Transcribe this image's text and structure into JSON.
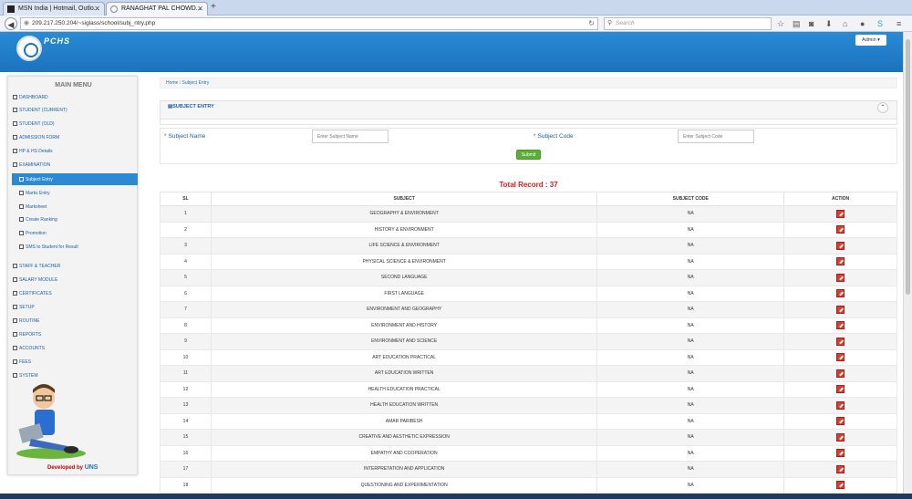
{
  "browser": {
    "tabs": [
      {
        "title": "MSN India | Hotmail, Outlo..."
      },
      {
        "title": "RANAGHAT PAL CHOWD..."
      }
    ],
    "url": "209.217.250.204/~siglass/school/subj_ntry.php",
    "search_placeholder": "Search"
  },
  "header": {
    "brand": "PCHS",
    "admin_label": "Admin ▾"
  },
  "sidebar": {
    "title": "MAIN MENU",
    "items": [
      {
        "label": "DASHBOARD",
        "level": 0
      },
      {
        "label": "STUDENT (CURRENT)",
        "level": 0
      },
      {
        "label": "STUDENT (OLD)",
        "level": 0
      },
      {
        "label": "ADMISSION FORM",
        "level": 0
      },
      {
        "label": "HP & HS Details",
        "level": 0
      },
      {
        "label": "EXAMINATION",
        "level": 0
      },
      {
        "label": "Subject Entry",
        "level": 1,
        "active": true
      },
      {
        "label": "Marks Entry",
        "level": 1
      },
      {
        "label": "Marksheet",
        "level": 1
      },
      {
        "label": "Create Ranking",
        "level": 1
      },
      {
        "label": "Promotion",
        "level": 1
      },
      {
        "label": "SMS to Student for Result",
        "level": 1
      },
      {
        "label": "STAFF & TEACHER",
        "level": 0
      },
      {
        "label": "SALARY MODULE",
        "level": 0
      },
      {
        "label": "CERTIFICATES",
        "level": 0
      },
      {
        "label": "SETUP",
        "level": 0
      },
      {
        "label": "ROUTINE",
        "level": 0
      },
      {
        "label": "REPORTS",
        "level": 0
      },
      {
        "label": "ACCOUNTS",
        "level": 0
      },
      {
        "label": "FEES",
        "level": 0
      },
      {
        "label": "SYSTEM",
        "level": 0
      }
    ],
    "developed_by": "Developed by",
    "developer": "UNS"
  },
  "breadcrumb": {
    "home": "Home",
    "current": "Subject Entry"
  },
  "panel": {
    "title": "SUBJECT ENTRY"
  },
  "form": {
    "subject_name_label": "Subject Name",
    "subject_name_placeholder": "Enter Subject Name",
    "subject_code_label": "Subject Code",
    "subject_code_placeholder": "Enter Subject Code",
    "submit_label": "Submit"
  },
  "table": {
    "total_record": "Total Record : 37",
    "columns": [
      "SL",
      "SUBJECT",
      "SUBJECT CODE",
      "ACTION"
    ],
    "rows": [
      {
        "sl": "1",
        "subject": "GEOGRAPHY & ENVIRONMENT",
        "code": "NA"
      },
      {
        "sl": "2",
        "subject": "HISTORY & ENVIRONMENT",
        "code": "NA"
      },
      {
        "sl": "3",
        "subject": "LIFE SCIENCE & ENVIRONMENT",
        "code": "NA"
      },
      {
        "sl": "4",
        "subject": "PHYSICAL SCIENCE & ENVIRONMENT",
        "code": "NA"
      },
      {
        "sl": "5",
        "subject": "SECOND LANGUAGE",
        "code": "NA"
      },
      {
        "sl": "6",
        "subject": "FIRST LANGUAGE",
        "code": "NA"
      },
      {
        "sl": "7",
        "subject": "ENVIRONMENT AND GEOGRAPHY",
        "code": "NA"
      },
      {
        "sl": "8",
        "subject": "ENVIRONMENT AND HISTORY",
        "code": "NA"
      },
      {
        "sl": "9",
        "subject": "ENVIRONMENT AND SCIENCE",
        "code": "NA"
      },
      {
        "sl": "10",
        "subject": "ART EDUCATION PRACTICAL",
        "code": "NA"
      },
      {
        "sl": "11",
        "subject": "ART EDUCATION WRITTEN",
        "code": "NA"
      },
      {
        "sl": "12",
        "subject": "HEALTH EDUCATION PRACTICAL",
        "code": "NA"
      },
      {
        "sl": "13",
        "subject": "HEALTH EDUCATION WRITTEN",
        "code": "NA"
      },
      {
        "sl": "14",
        "subject": "AMAR PARIBESH",
        "code": "NA"
      },
      {
        "sl": "15",
        "subject": "CREATIVE AND AESTHETIC EXPRESSION",
        "code": "NA"
      },
      {
        "sl": "16",
        "subject": "EMPATHY AND COOPERATION",
        "code": "NA"
      },
      {
        "sl": "17",
        "subject": "INTERPRETATION AND APPLICATION",
        "code": "NA"
      },
      {
        "sl": "18",
        "subject": "QUESTIONING AND EXPERIMENTATION",
        "code": "NA"
      }
    ]
  },
  "colors": {
    "header": "#1b72bd",
    "accent": "#2c8ad3",
    "total": "#e01b1b",
    "submit": "#5cae39",
    "edit": "#e23a2a"
  }
}
